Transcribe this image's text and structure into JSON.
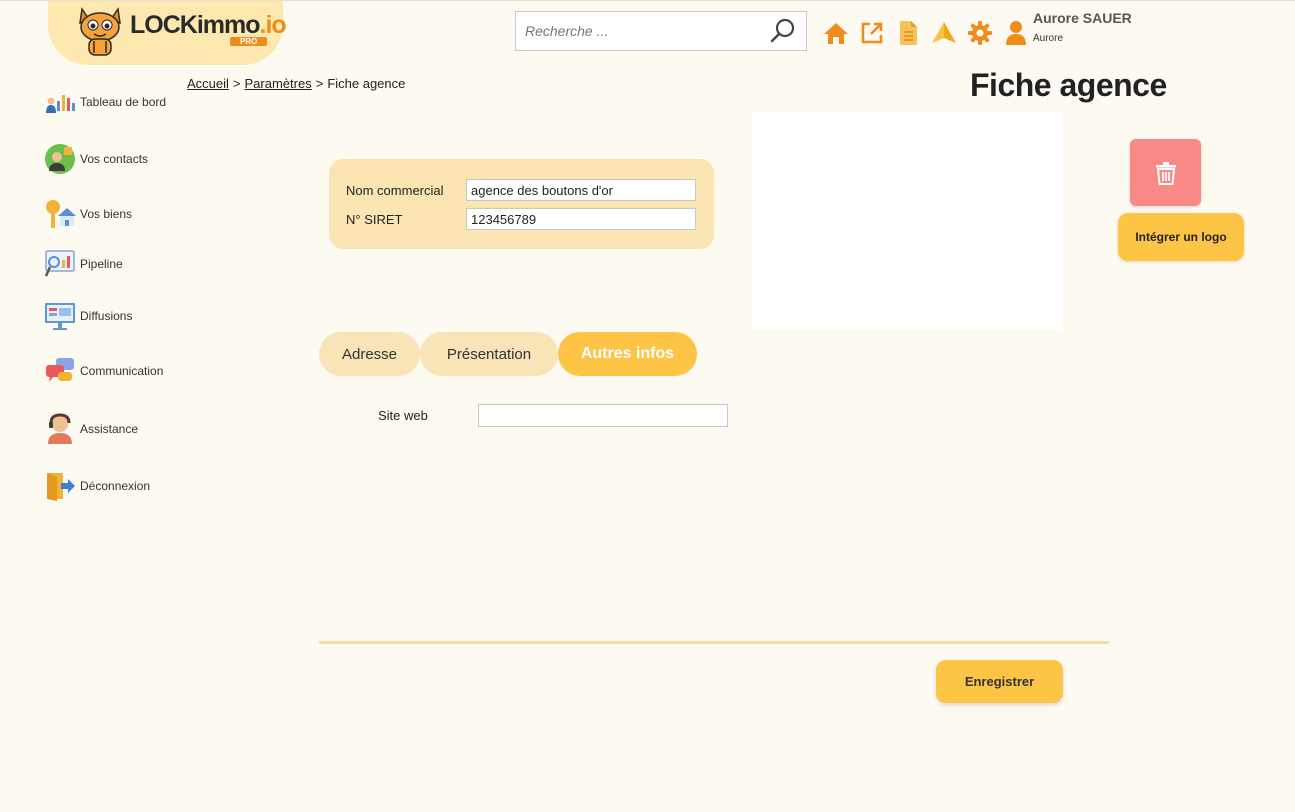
{
  "brand": {
    "logo_main": "LOCKimmo",
    "logo_suffix": ".io",
    "logo_badge": "PRO",
    "accent": "#f08c1c",
    "button_yellow": "#fec446",
    "panel_cream": "#fbe6b3",
    "danger": "#f98a85"
  },
  "search": {
    "placeholder": "Recherche ..."
  },
  "toolbar_icons": [
    "home-icon",
    "external-link-icon",
    "document-icon",
    "paper-plane-icon",
    "gear-icon",
    "user-icon"
  ],
  "user": {
    "name": "Aurore SAUER",
    "subtitle": "Aurore"
  },
  "sidebar": {
    "items": [
      {
        "label": "Tableau de bord",
        "icon": "dashboard-icon"
      },
      {
        "label": "Vos contacts",
        "icon": "contacts-icon"
      },
      {
        "label": "Vos biens",
        "icon": "properties-icon"
      },
      {
        "label": "Pipeline",
        "icon": "pipeline-icon"
      },
      {
        "label": "Diffusions",
        "icon": "diffusion-icon"
      },
      {
        "label": "Communication",
        "icon": "chat-icon"
      },
      {
        "label": "Assistance",
        "icon": "support-icon"
      },
      {
        "label": "Déconnexion",
        "icon": "logout-icon"
      }
    ]
  },
  "breadcrumb": {
    "home": "Accueil",
    "settings": "Paramètres",
    "current": "Fiche agence",
    "separator": ">"
  },
  "page": {
    "title": "Fiche agence"
  },
  "identity": {
    "name_label": "Nom commercial",
    "name_value": "agence des boutons d'or",
    "siret_label": "N° SIRET",
    "siret_value": "123456789"
  },
  "logo_panel": {
    "integrate_label": "Intégrer un logo",
    "delete_icon": "trash-icon"
  },
  "tabs": [
    {
      "label": "Adresse",
      "active": false
    },
    {
      "label": "Présentation",
      "active": false
    },
    {
      "label": "Autres infos",
      "active": true
    }
  ],
  "other_info": {
    "site_label": "Site web",
    "site_value": ""
  },
  "actions": {
    "save_label": "Enregistrer"
  }
}
